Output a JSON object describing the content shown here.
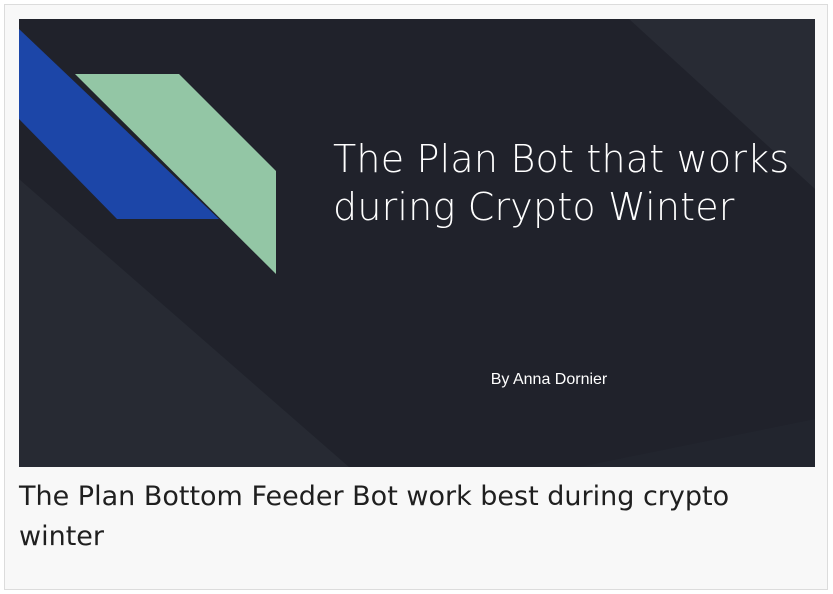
{
  "slide": {
    "title": "The Plan Bot that works during Crypto Winter",
    "subtitle": "By Anna Dornier",
    "colors": {
      "background": "#20222b",
      "blue_stripe": "#1c46a8",
      "green_stripe": "#93c6a5"
    }
  },
  "caption": "The Plan Bottom Feeder Bot work best during crypto winter"
}
